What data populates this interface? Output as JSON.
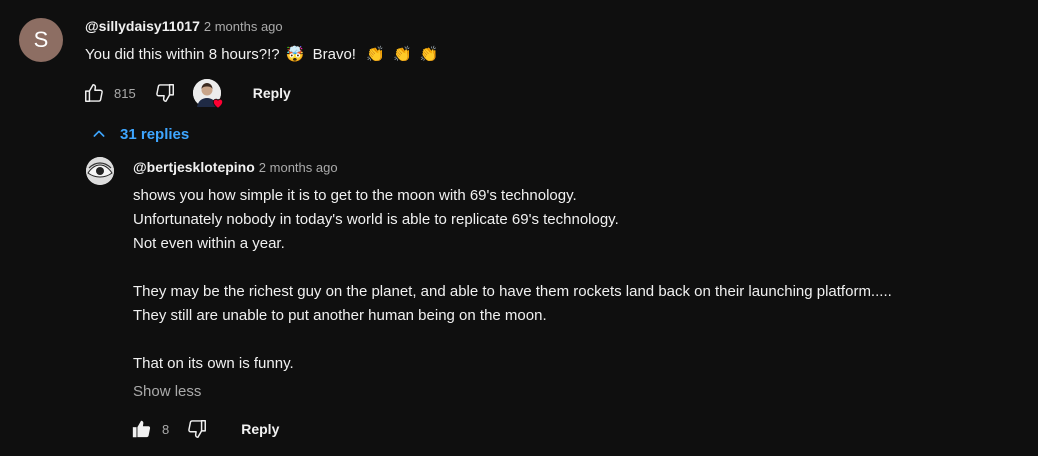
{
  "comment": {
    "avatar_letter": "S",
    "handle": "@sillydaisy11017",
    "time": "2 months ago",
    "text": "You did this within 8 hours?!? 🤯 Bravo! 👏 👏 👏",
    "text_main": "You did this within 8 hours?!?",
    "emoji_mind_blown": "🤯",
    "text_bravo": "Bravo!",
    "emoji_clap": "👏",
    "likes": "815",
    "reply_label": "Reply",
    "replies_toggle": "31 replies"
  },
  "reply": {
    "handle": "@bertjesklotepino",
    "time": "2 months ago",
    "lines": [
      "shows you how simple it is to get to the moon with 69's technology.",
      "Unfortunately nobody in today's world is able to replicate 69's technology.",
      "Not even within a year.",
      "",
      "They may be the richest guy on the planet, and able to have them rockets land back on their launching platform.....",
      "They still are unable to put another human being on the moon.",
      "",
      "That on its own is funny."
    ],
    "show_less": "Show less",
    "likes": "8",
    "reply_label": "Reply"
  },
  "colors": {
    "background": "#0f0f0f",
    "text": "#f1f1f1",
    "muted": "#aaaaaa",
    "link_blue": "#3ea6ff",
    "avatar_s": "#8d6e63",
    "heart": "#ff0033"
  }
}
